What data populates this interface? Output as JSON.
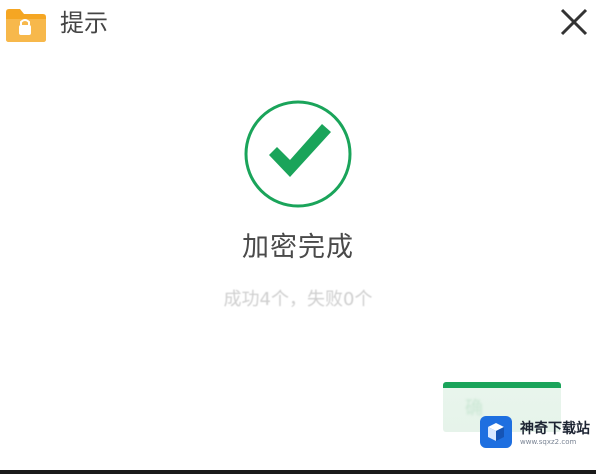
{
  "window": {
    "title": "提示",
    "icon": "folder-icon",
    "close_icon": "close-icon"
  },
  "status": {
    "icon": "check-circle-icon",
    "title": "加密完成",
    "detail": "成功4个，失败0个"
  },
  "action_button": {
    "label": "确"
  },
  "watermark": {
    "name": "神奇下载站",
    "url": "www.sqxz2.com"
  },
  "colors": {
    "accent": "#1aa45a",
    "title_text": "#444444",
    "detail_text": "#cfcfcf"
  }
}
